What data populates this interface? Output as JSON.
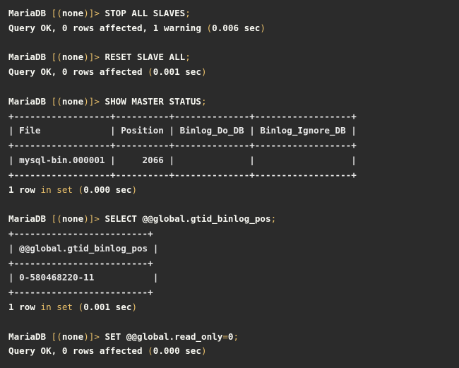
{
  "lines": [
    [
      {
        "t": "MariaDB ",
        "c": "c-white"
      },
      {
        "t": "[(",
        "c": "c-punct"
      },
      {
        "t": "none",
        "c": "c-white"
      },
      {
        "t": ")]>",
        "c": "c-punct"
      },
      {
        "t": " STOP ALL SLAVES",
        "c": "c-white"
      },
      {
        "t": ";",
        "c": "c-punct"
      }
    ],
    [
      {
        "t": "Query OK, 0 rows affected, 1 warning ",
        "c": "c-white"
      },
      {
        "t": "(",
        "c": "c-punct"
      },
      {
        "t": "0.006 sec",
        "c": "c-white"
      },
      {
        "t": ")",
        "c": "c-punct"
      }
    ],
    [],
    [
      {
        "t": "MariaDB ",
        "c": "c-white"
      },
      {
        "t": "[(",
        "c": "c-punct"
      },
      {
        "t": "none",
        "c": "c-white"
      },
      {
        "t": ")]>",
        "c": "c-punct"
      },
      {
        "t": " RESET SLAVE ALL",
        "c": "c-white"
      },
      {
        "t": ";",
        "c": "c-punct"
      }
    ],
    [
      {
        "t": "Query OK, 0 rows affected ",
        "c": "c-white"
      },
      {
        "t": "(",
        "c": "c-punct"
      },
      {
        "t": "0.001 sec",
        "c": "c-white"
      },
      {
        "t": ")",
        "c": "c-punct"
      }
    ],
    [],
    [
      {
        "t": "MariaDB ",
        "c": "c-white"
      },
      {
        "t": "[(",
        "c": "c-punct"
      },
      {
        "t": "none",
        "c": "c-white"
      },
      {
        "t": ")]>",
        "c": "c-punct"
      },
      {
        "t": " SHOW MASTER STATUS",
        "c": "c-white"
      },
      {
        "t": ";",
        "c": "c-punct"
      }
    ],
    [
      {
        "t": "+------------------+----------+--------------+------------------+",
        "c": "c-border"
      }
    ],
    [
      {
        "t": "| File             | Position | Binlog_Do_DB | Binlog_Ignore_DB |",
        "c": "c-border"
      }
    ],
    [
      {
        "t": "+------------------+----------+--------------+------------------+",
        "c": "c-border"
      }
    ],
    [
      {
        "t": "| mysql-bin.000001 |     2066 |              |                  |",
        "c": "c-border"
      }
    ],
    [
      {
        "t": "+------------------+----------+--------------+------------------+",
        "c": "c-border"
      }
    ],
    [
      {
        "t": "1 row ",
        "c": "c-white"
      },
      {
        "t": "in set",
        "c": "c-orange"
      },
      {
        "t": " ",
        "c": "c-white"
      },
      {
        "t": "(",
        "c": "c-punct"
      },
      {
        "t": "0.000 sec",
        "c": "c-white"
      },
      {
        "t": ")",
        "c": "c-punct"
      }
    ],
    [],
    [
      {
        "t": "MariaDB ",
        "c": "c-white"
      },
      {
        "t": "[(",
        "c": "c-punct"
      },
      {
        "t": "none",
        "c": "c-white"
      },
      {
        "t": ")]>",
        "c": "c-punct"
      },
      {
        "t": " SELECT @@global.gtid_binlog_pos",
        "c": "c-white"
      },
      {
        "t": ";",
        "c": "c-punct"
      }
    ],
    [
      {
        "t": "+-------------------------+",
        "c": "c-border"
      }
    ],
    [
      {
        "t": "| @@global.gtid_binlog_pos |",
        "c": "c-border"
      }
    ],
    [
      {
        "t": "+-------------------------+",
        "c": "c-border"
      }
    ],
    [
      {
        "t": "| 0-580468220-11           |",
        "c": "c-border"
      }
    ],
    [
      {
        "t": "+-------------------------+",
        "c": "c-border"
      }
    ],
    [
      {
        "t": "1 row ",
        "c": "c-white"
      },
      {
        "t": "in set",
        "c": "c-orange"
      },
      {
        "t": " ",
        "c": "c-white"
      },
      {
        "t": "(",
        "c": "c-punct"
      },
      {
        "t": "0.001 sec",
        "c": "c-white"
      },
      {
        "t": ")",
        "c": "c-punct"
      }
    ],
    [],
    [
      {
        "t": "MariaDB ",
        "c": "c-white"
      },
      {
        "t": "[(",
        "c": "c-punct"
      },
      {
        "t": "none",
        "c": "c-white"
      },
      {
        "t": ")]>",
        "c": "c-punct"
      },
      {
        "t": " SET @@global.read_only",
        "c": "c-white"
      },
      {
        "t": "=",
        "c": "c-punct"
      },
      {
        "t": "0",
        "c": "c-white"
      },
      {
        "t": ";",
        "c": "c-punct"
      }
    ],
    [
      {
        "t": "Query OK, 0 rows affected ",
        "c": "c-white"
      },
      {
        "t": "(",
        "c": "c-punct"
      },
      {
        "t": "0.000 sec",
        "c": "c-white"
      },
      {
        "t": ")",
        "c": "c-punct"
      }
    ]
  ],
  "colors": {
    "background": "#2b2b2b",
    "text": "#f8f8f2",
    "accent": "#e8bf6a"
  }
}
